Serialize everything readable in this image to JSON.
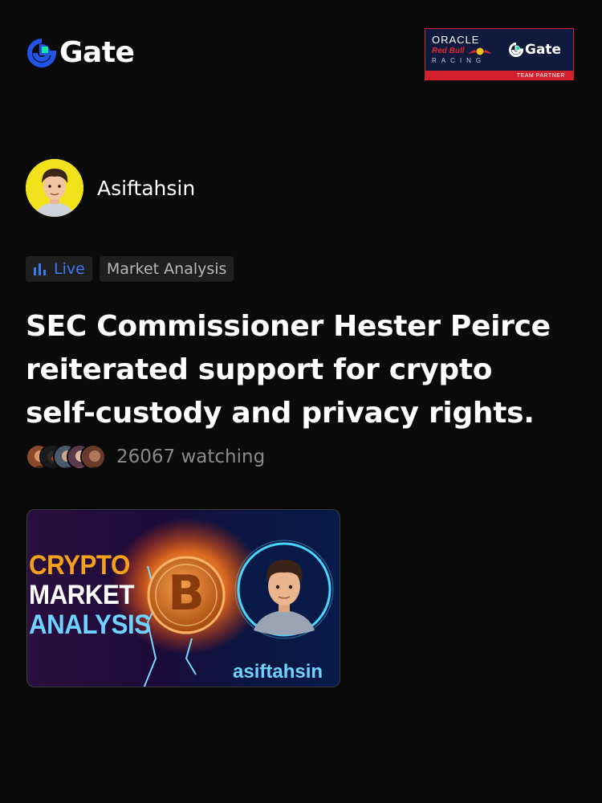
{
  "brand": {
    "name": "Gate",
    "logo_icon": "gate-logo-icon"
  },
  "partner": {
    "oracle": "ORACLE",
    "redbull": "Red Bull",
    "racing": "RACING",
    "gate": "Gate",
    "role": "TEAM PARTNER"
  },
  "author": {
    "name": "Asiftahsin",
    "avatar_icon": "user-avatar"
  },
  "tags": [
    {
      "label": "Live",
      "icon": "live-bars-icon",
      "color": "#3d7bf2"
    },
    {
      "label": "Market Analysis"
    }
  ],
  "post": {
    "title": "SEC Commissioner Hester Peirce reiterated support for crypto self-custody and privacy rights."
  },
  "watchers": {
    "count_text": "26067 watching"
  },
  "thumbnail": {
    "line1": "CRYPTO",
    "line2": "MARKET",
    "line3": "ANALYSIS",
    "handle": "asiftahsin",
    "coin_symbol": "B"
  },
  "colors": {
    "background": "#0a0a0a",
    "accent_blue": "#3d7bf2",
    "logo_green": "#17e6a1",
    "logo_blue": "#2354e6"
  }
}
